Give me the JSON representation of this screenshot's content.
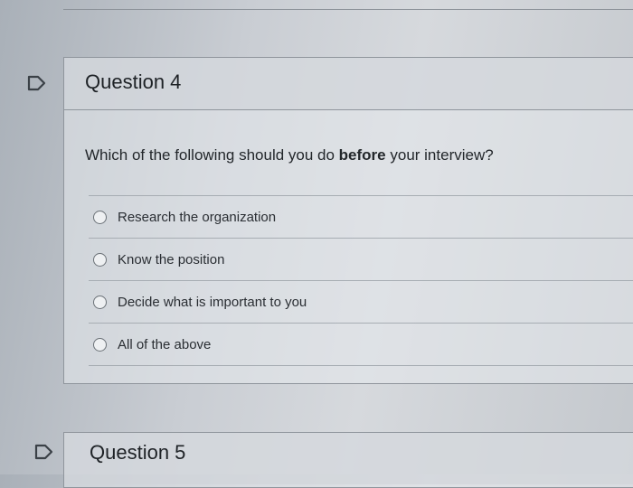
{
  "questions": [
    {
      "title": "Question 4",
      "text_before": "Which of the following should you do ",
      "text_bold": "before",
      "text_after": " your interview?",
      "answers": [
        "Research the organization",
        "Know the position",
        "Decide what is important to you",
        "All of the above"
      ]
    },
    {
      "title": "Question 5"
    }
  ],
  "icons": {
    "flag": "flag-outline-icon"
  },
  "colors": {
    "flag_outline": "#3b4147",
    "card_border": "#8f959c"
  }
}
